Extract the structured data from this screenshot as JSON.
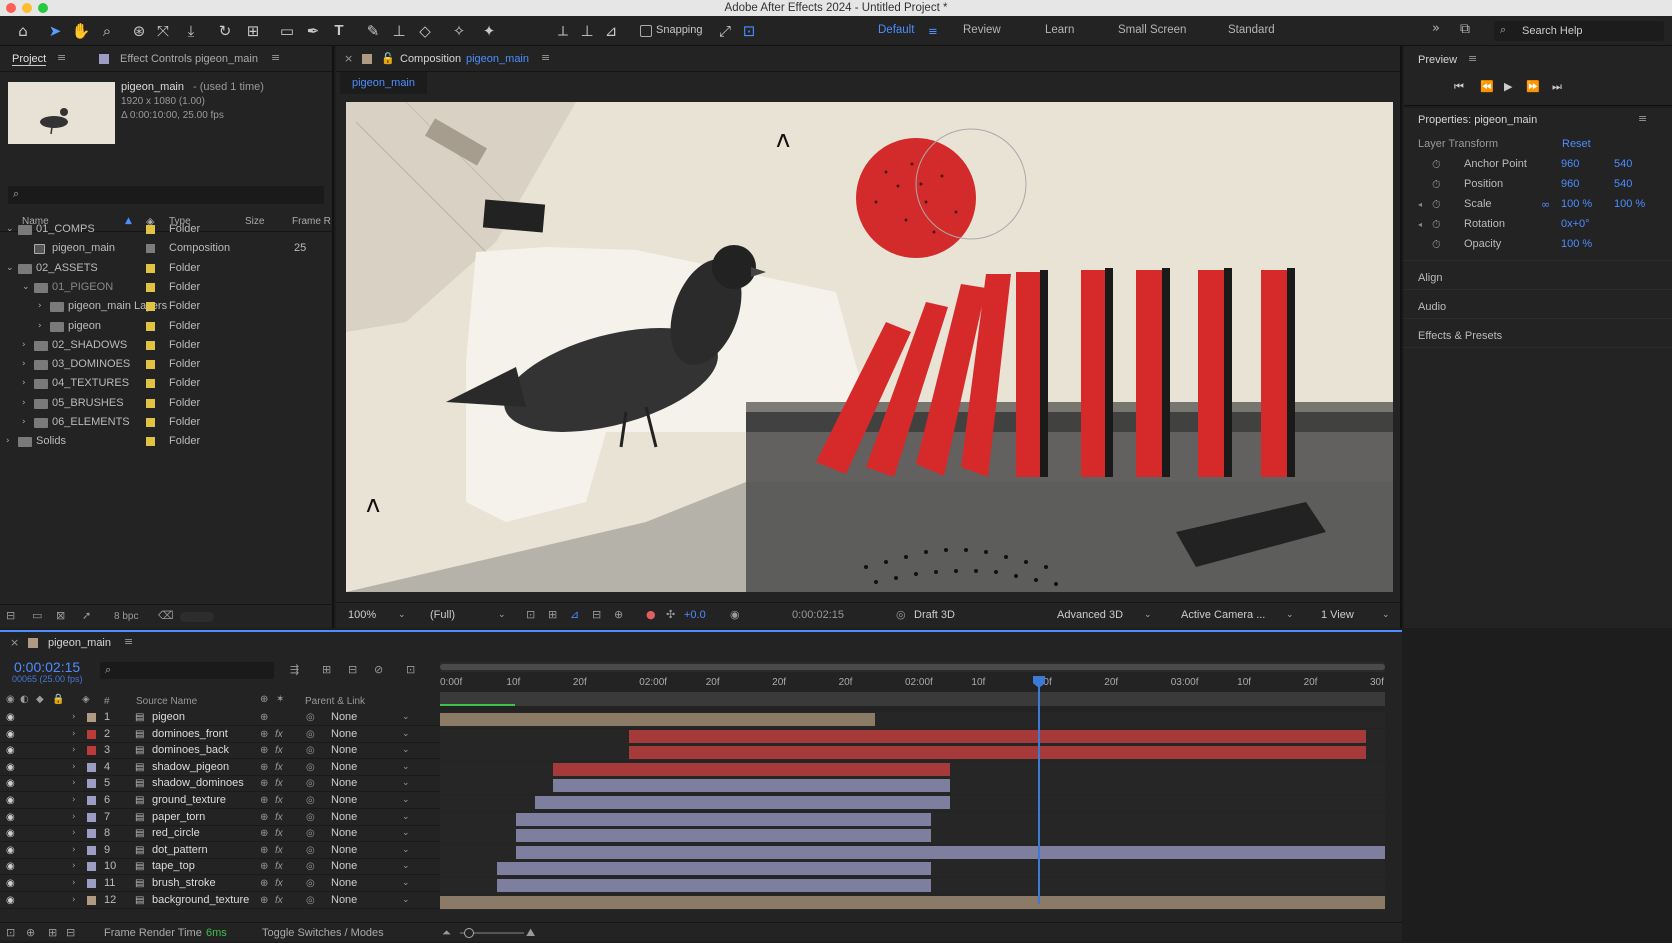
{
  "app": {
    "title": "Adobe After Effects 2024 - Untitled Project *"
  },
  "toolbar": {
    "snapping_label": "Snapping",
    "workspaces": [
      "Default",
      "Review",
      "Learn",
      "Small Screen",
      "Standard"
    ],
    "search_placeholder": "Search Help"
  },
  "project": {
    "tab_label": "Project",
    "effect_controls_label": "Effect Controls pigeon_main",
    "asset_name": "pigeon_main",
    "asset_used": "- (used 1 time)",
    "asset_dims": "1920 x 1080 (1.00)",
    "asset_duration": "Δ 0:00:10:00, 25.00 fps",
    "columns": {
      "name": "Name",
      "type": "Type",
      "size": "Size",
      "frame_rate": "Frame R"
    },
    "items": [
      {
        "name": "01_COMPS",
        "type": "Folder",
        "size": "",
        "swatch": "#e2c243"
      },
      {
        "name": "pigeon_main",
        "type": "Composition",
        "size": "25",
        "swatch": "#7c7c7c"
      },
      {
        "name": "02_ASSETS",
        "type": "Folder",
        "size": "",
        "swatch": "#e2c243"
      },
      {
        "name": "01_PIGEON",
        "type": "Folder",
        "size": "",
        "swatch": "#e2c243"
      },
      {
        "name": "pigeon_main Layers",
        "type": "Folder",
        "size": "",
        "swatch": "#e2c243"
      },
      {
        "name": "pigeon",
        "type": "Folder",
        "size": "",
        "swatch": "#e2c243"
      },
      {
        "name": "02_SHADOWS",
        "type": "Folder",
        "size": "",
        "swatch": "#e2c243"
      },
      {
        "name": "03_DOMINOES",
        "type": "Folder",
        "size": "",
        "swatch": "#e2c243"
      },
      {
        "name": "04_TEXTURES",
        "type": "Folder",
        "size": "",
        "swatch": "#e2c243"
      },
      {
        "name": "05_BRUSHES",
        "type": "Folder",
        "size": "",
        "swatch": "#e2c243"
      },
      {
        "name": "06_ELEMENTS",
        "type": "Folder",
        "size": "",
        "swatch": "#e2c243"
      },
      {
        "name": "Solids",
        "type": "Folder",
        "size": "",
        "swatch": "#e2c243"
      }
    ],
    "bpc": "8 bpc"
  },
  "composition": {
    "tab_prefix": "Composition",
    "tab_name": "pigeon_main",
    "sub_tab": "pigeon_main",
    "zoom": "100%",
    "resolution": "(Full)",
    "exposure": "+0.0",
    "timecode": "0:00:02:15",
    "renderer": "Draft 3D",
    "renderer_mode": "Advanced 3D",
    "camera": "Active Camera ...",
    "views": "1 View"
  },
  "preview": {
    "title": "Preview"
  },
  "properties": {
    "title": "Properties: pigeon_main",
    "section": "Layer Transform",
    "reset": "Reset",
    "rows": [
      {
        "label": "Anchor Point",
        "v1": "960",
        "v2": "540"
      },
      {
        "label": "Position",
        "v1": "960",
        "v2": "540"
      },
      {
        "label": "Scale",
        "v1": "100 %",
        "v2": "100 %"
      },
      {
        "label": "Rotation",
        "v1": "0x+0°",
        "v2": ""
      },
      {
        "label": "Opacity",
        "v1": "100 %",
        "v2": ""
      }
    ],
    "collapsed": [
      "Align",
      "Audio",
      "Effects & Presets"
    ]
  },
  "timeline": {
    "tab": "pigeon_main",
    "timecode": "0:00:02:15",
    "frames": "00065 (25.00 fps)",
    "headers": {
      "num": "#",
      "source": "Source Name",
      "parent": "Parent & Link"
    },
    "ruler": [
      "0:00f",
      "10f",
      "20f",
      "02:00f",
      "20f",
      "20f",
      "20f",
      "02:00f",
      "10f",
      "20f",
      "20f",
      "03:00f",
      "10f",
      "20f",
      "30f"
    ],
    "layers": [
      {
        "num": "1",
        "name": "pigeon",
        "parent": "None",
        "color": "#b09a83",
        "fx": false
      },
      {
        "num": "2",
        "name": "dominoes_front",
        "parent": "None",
        "color": "#bb3a3a",
        "fx": true
      },
      {
        "num": "3",
        "name": "dominoes_back",
        "parent": "None",
        "color": "#bb3a3a",
        "fx": true
      },
      {
        "num": "4",
        "name": "shadow_pigeon",
        "parent": "None",
        "color": "#9c9cc4",
        "fx": true
      },
      {
        "num": "5",
        "name": "shadow_dominoes",
        "parent": "None",
        "color": "#9c9cc4",
        "fx": true
      },
      {
        "num": "6",
        "name": "ground_texture",
        "parent": "None",
        "color": "#9c9cc4",
        "fx": true
      },
      {
        "num": "7",
        "name": "paper_torn",
        "parent": "None",
        "color": "#9c9cc4",
        "fx": true
      },
      {
        "num": "8",
        "name": "red_circle",
        "parent": "None",
        "color": "#9c9cc4",
        "fx": true
      },
      {
        "num": "9",
        "name": "dot_pattern",
        "parent": "None",
        "color": "#9c9cc4",
        "fx": true
      },
      {
        "num": "10",
        "name": "tape_top",
        "parent": "None",
        "color": "#9c9cc4",
        "fx": true
      },
      {
        "num": "11",
        "name": "brush_stroke",
        "parent": "None",
        "color": "#9c9cc4",
        "fx": true
      },
      {
        "num": "12",
        "name": "background_texture",
        "parent": "None",
        "color": "#b09a83",
        "fx": true
      }
    ],
    "frame_render_label": "Frame Render Time",
    "frame_render_value": "6ms",
    "toggle_label": "Toggle Switches / Modes"
  }
}
